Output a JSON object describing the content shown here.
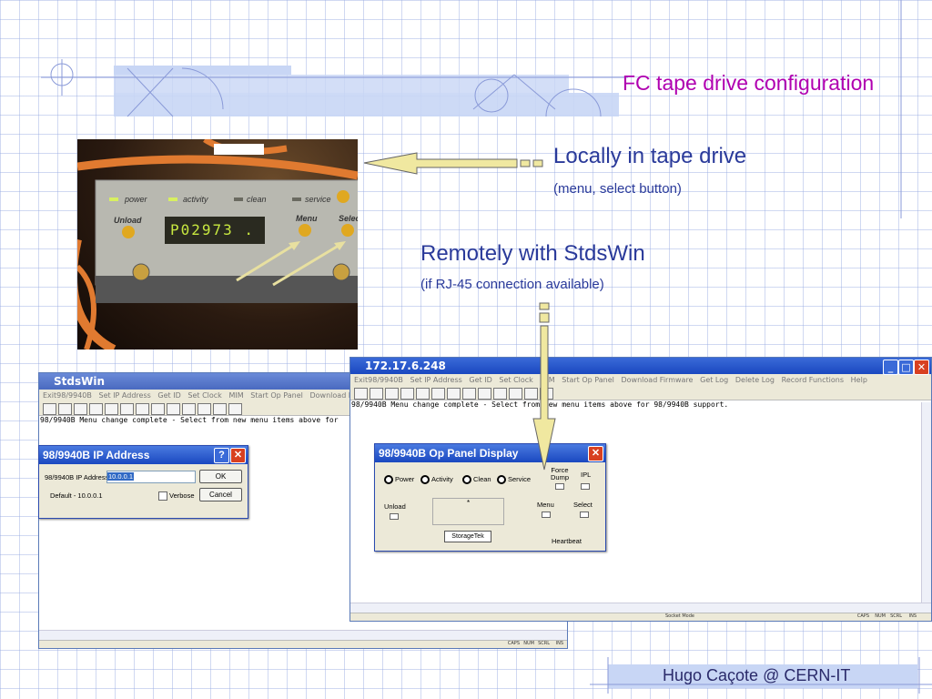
{
  "slide": {
    "title": "FC tape drive configuration",
    "local_heading": "Locally in tape drive",
    "local_sub": "(menu, select button)",
    "remote_heading": "Remotely with StdsWin",
    "remote_sub": "(if RJ-45 connection available)",
    "footer": "Hugo Caçote @ CERN-IT"
  },
  "photo": {
    "indicators": [
      "power",
      "activity",
      "clean",
      "service"
    ],
    "buttons": [
      "Unload",
      "Menu",
      "Select"
    ],
    "display": "P02973 ."
  },
  "win_left": {
    "title": "StdsWin",
    "menu": [
      "Exit98/9940B",
      "Set IP Address",
      "Get ID",
      "Set Clock",
      "MIM",
      "Start Op Panel",
      "Download Firmwa"
    ],
    "console": "98/9940B Menu change complete - Select from new menu items above for",
    "status": [
      "CAPS",
      "NUM",
      "SCRL",
      "INS"
    ]
  },
  "ip_dialog": {
    "title": "98/9940B IP Address",
    "label": "98/9940B IP Address",
    "value": "10.0.0.1",
    "default": "Default - 10.0.0.1",
    "verbose": "Verbose",
    "ok": "OK",
    "cancel": "Cancel"
  },
  "win_right": {
    "title": "172.17.6.248",
    "menu": [
      "Exit98/9940B",
      "Set IP Address",
      "Get ID",
      "Set Clock",
      "MIM",
      "Start Op Panel",
      "Download Firmware",
      "Get Log",
      "Delete Log",
      "Record Functions",
      "Help"
    ],
    "console": "98/9940B Menu change complete - Select from new menu items above for 98/9940B support.",
    "status_mode": "Socket Mode",
    "status": [
      "CAPS",
      "NUM",
      "SCRL",
      "INS"
    ]
  },
  "op_panel": {
    "title": "98/9940B Op Panel Display",
    "radios": [
      "Power",
      "Activity",
      "Clean",
      "Service"
    ],
    "force_dump": "Force Dump",
    "ipl": "IPL",
    "unload": "Unload",
    "display": "*",
    "menu": "Menu",
    "select": "Select",
    "brand": "StorageTek",
    "heartbeat": "Heartbeat"
  },
  "colors": {
    "title": "#b000b0",
    "text": "#2a3a9a",
    "arrow_fill": "#f0e8a0",
    "titlebar": "#1a48c0"
  }
}
